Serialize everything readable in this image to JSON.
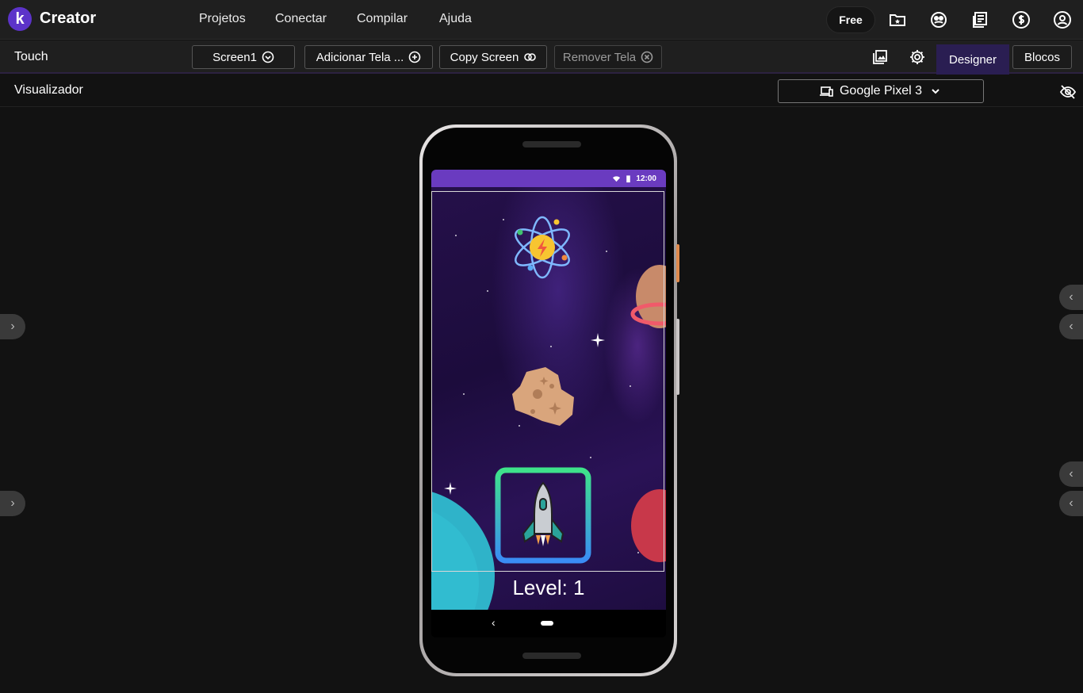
{
  "app": {
    "brand": "Creator",
    "logo_letter": "k",
    "plan": "Free"
  },
  "menu": [
    "Projetos",
    "Conectar",
    "Compilar",
    "Ajuda"
  ],
  "toolbar": {
    "project_name": "Touch",
    "screen_select": "Screen1",
    "add_screen": "Adicionar Tela ...",
    "copy_screen": "Copy Screen",
    "remove_screen": "Remover Tela",
    "tab_designer": "Designer",
    "tab_blocks": "Blocos"
  },
  "viewer": {
    "title": "Visualizador",
    "device": "Google Pixel 3"
  },
  "phone": {
    "status_time": "12:00",
    "level_label": "Level: 1"
  },
  "colors": {
    "accent": "#5c33c9",
    "statusbar": "#6a3bc0",
    "designer_tab": "#2a1e52"
  },
  "icons": [
    "folder-star-icon",
    "community-icon",
    "docs-icon",
    "dollar-icon",
    "account-icon",
    "gallery-icon",
    "settings-icon",
    "eye-off-icon",
    "atom-icon",
    "asteroid-icon",
    "rocket-icon",
    "planet-icon"
  ]
}
